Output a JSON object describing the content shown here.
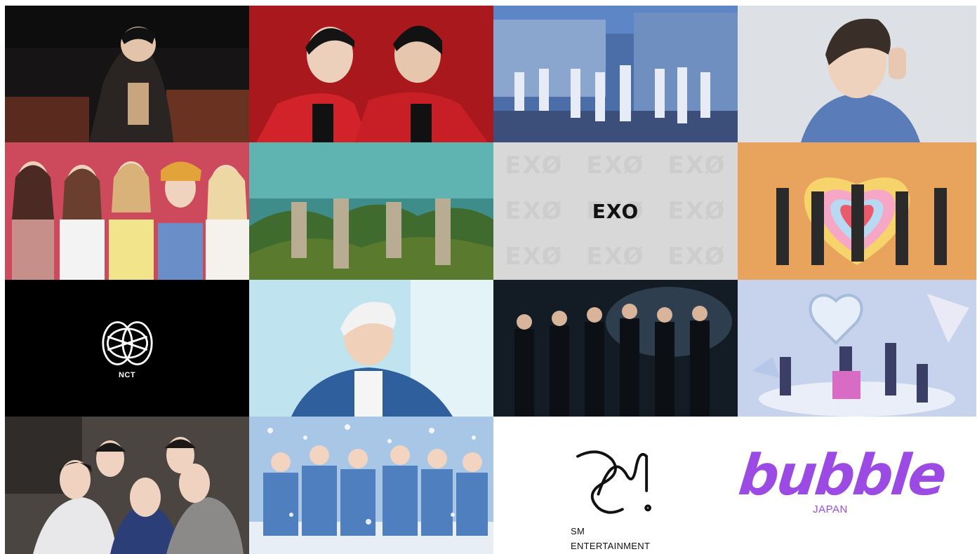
{
  "tiles": [
    {
      "id": "artist-1",
      "kind": "photo",
      "bg": "#1a1a1a"
    },
    {
      "id": "artist-2",
      "kind": "photo",
      "bg": "#b31f24"
    },
    {
      "id": "artist-3",
      "kind": "photo",
      "bg": "#4c6fa8"
    },
    {
      "id": "artist-4",
      "kind": "photo",
      "bg": "#d9dde3"
    },
    {
      "id": "artist-5",
      "kind": "photo",
      "bg": "#d04a5e"
    },
    {
      "id": "artist-6",
      "kind": "photo",
      "bg": "#2f6f6a"
    },
    {
      "id": "exo",
      "kind": "logo"
    },
    {
      "id": "artist-8",
      "kind": "photo",
      "bg": "#f0a55c"
    },
    {
      "id": "nct",
      "kind": "logo"
    },
    {
      "id": "artist-10",
      "kind": "photo",
      "bg": "#bfe4f0"
    },
    {
      "id": "artist-11",
      "kind": "photo",
      "bg": "#16212c"
    },
    {
      "id": "artist-12",
      "kind": "photo",
      "bg": "#c9d4ec"
    },
    {
      "id": "artist-13",
      "kind": "photo",
      "bg": "#4b4643"
    },
    {
      "id": "artist-14",
      "kind": "photo",
      "bg": "#9fbfe0"
    }
  ],
  "exo": {
    "label": "EXO",
    "watermark": "EXØ"
  },
  "nct": {
    "label": "NCT"
  },
  "sm": {
    "line1": "SM",
    "line2": "ENTERTAINMENT"
  },
  "bubble": {
    "word": "bubble",
    "sub": "JAPAN",
    "color": "#9b4be3"
  }
}
